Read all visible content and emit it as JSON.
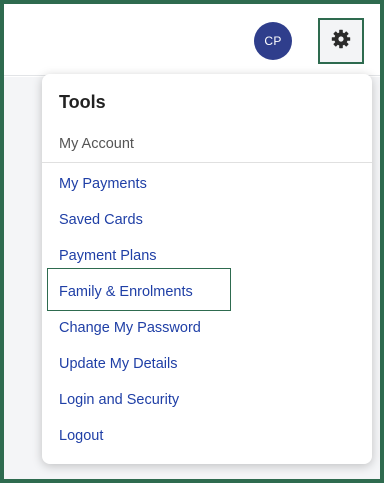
{
  "header": {
    "avatar_initials": "CP",
    "settings_icon": "gear-icon"
  },
  "colors": {
    "accent_frame": "#2e6b4f",
    "avatar_bg": "#2f3e8c",
    "link": "#1f3fa6"
  },
  "menu": {
    "title": "Tools",
    "section_label": "My Account",
    "items": [
      {
        "label": "My Payments"
      },
      {
        "label": "Saved Cards"
      },
      {
        "label": "Payment Plans"
      },
      {
        "label": "Family & Enrolments",
        "highlighted": true
      },
      {
        "label": "Change My Password"
      },
      {
        "label": "Update My Details"
      },
      {
        "label": "Login and Security"
      },
      {
        "label": "Logout"
      }
    ]
  }
}
